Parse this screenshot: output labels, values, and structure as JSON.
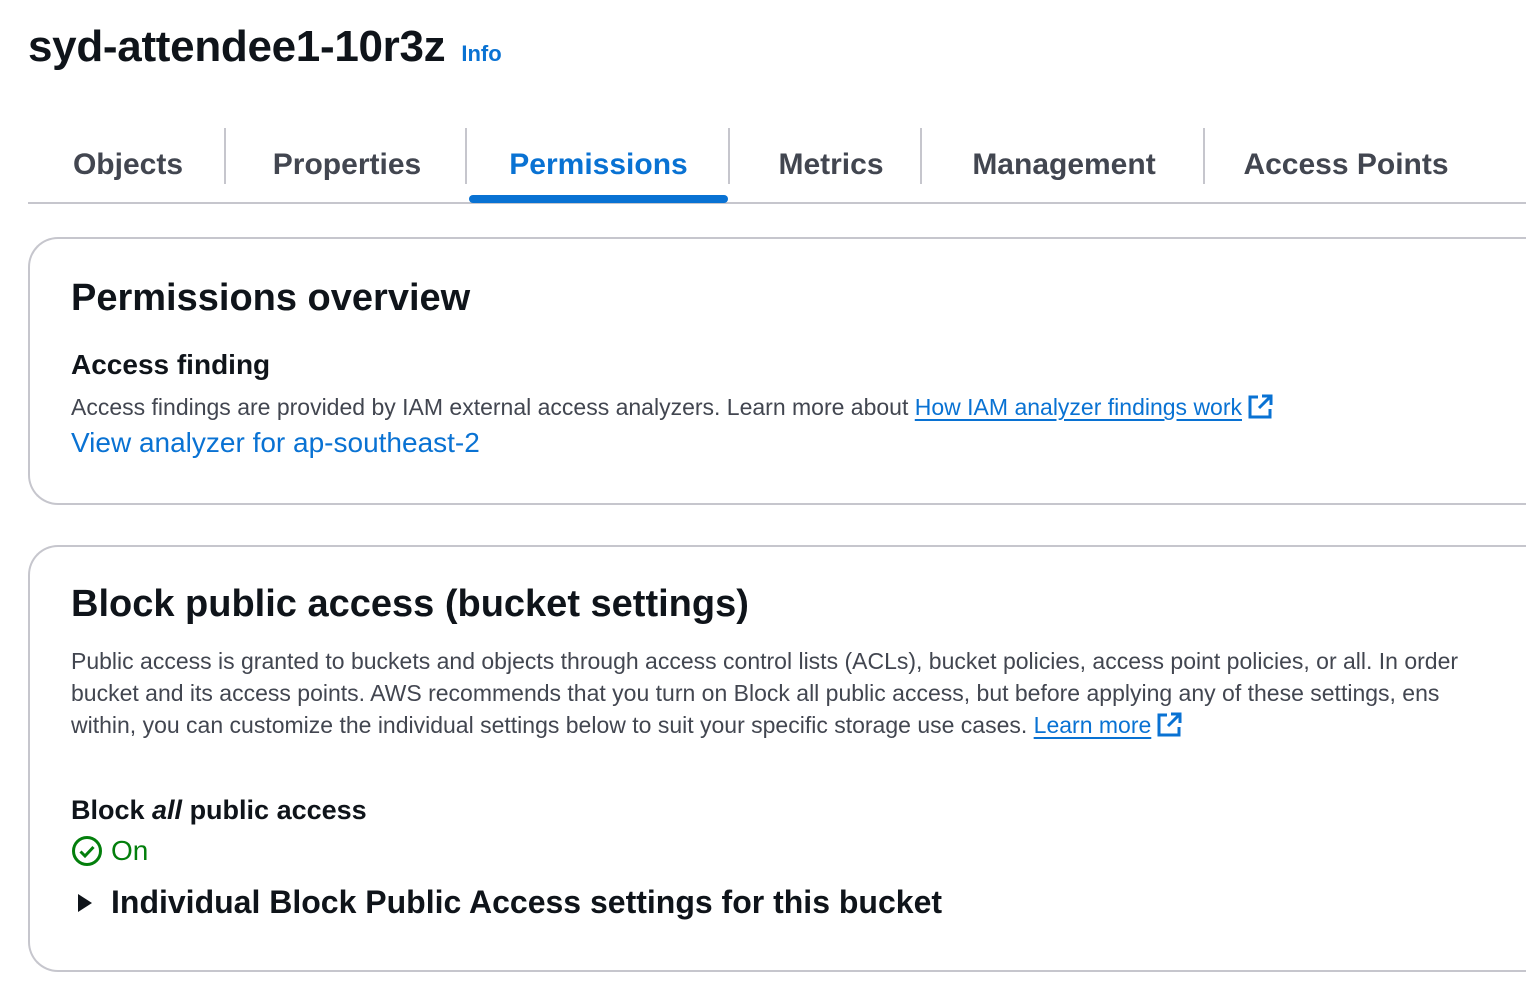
{
  "header": {
    "bucket_name": "syd-attendee1-10r3z",
    "info_label": "Info"
  },
  "tabs": [
    {
      "label": "Objects",
      "active": false
    },
    {
      "label": "Properties",
      "active": false
    },
    {
      "label": "Permissions",
      "active": true
    },
    {
      "label": "Metrics",
      "active": false
    },
    {
      "label": "Management",
      "active": false
    },
    {
      "label": "Access Points",
      "active": false
    }
  ],
  "permissions_overview": {
    "title": "Permissions overview",
    "access_finding_label": "Access finding",
    "description": "Access findings are provided by IAM external access analyzers. Learn more about ",
    "findings_link": "How IAM analyzer findings work",
    "analyzer_link": "View analyzer for ap-southeast-2"
  },
  "block_public_access": {
    "title": "Block public access (bucket settings)",
    "desc_line1": "Public access is granted to buckets and objects through access control lists (ACLs), bucket policies, access point policies, or all. In order",
    "desc_line2": "bucket and its access points. AWS recommends that you turn on Block all public access, but before applying any of these settings, ens",
    "desc_line3": "within, you can customize the individual settings below to suit your specific storage use cases. ",
    "learn_more": "Learn more",
    "block_all_prefix": "Block ",
    "block_all_emphasis": "all",
    "block_all_suffix": " public access",
    "status": "On",
    "expander_label": "Individual Block Public Access settings for this bucket"
  },
  "colors": {
    "link_blue": "#0972d3",
    "success_green": "#037f0c",
    "text_dark": "#0f141a",
    "text_muted": "#424650",
    "border": "#c6c6cd"
  },
  "icons": {
    "external_link": "external-link-icon",
    "status_check": "status-success-icon",
    "expander": "caret-right-icon"
  }
}
